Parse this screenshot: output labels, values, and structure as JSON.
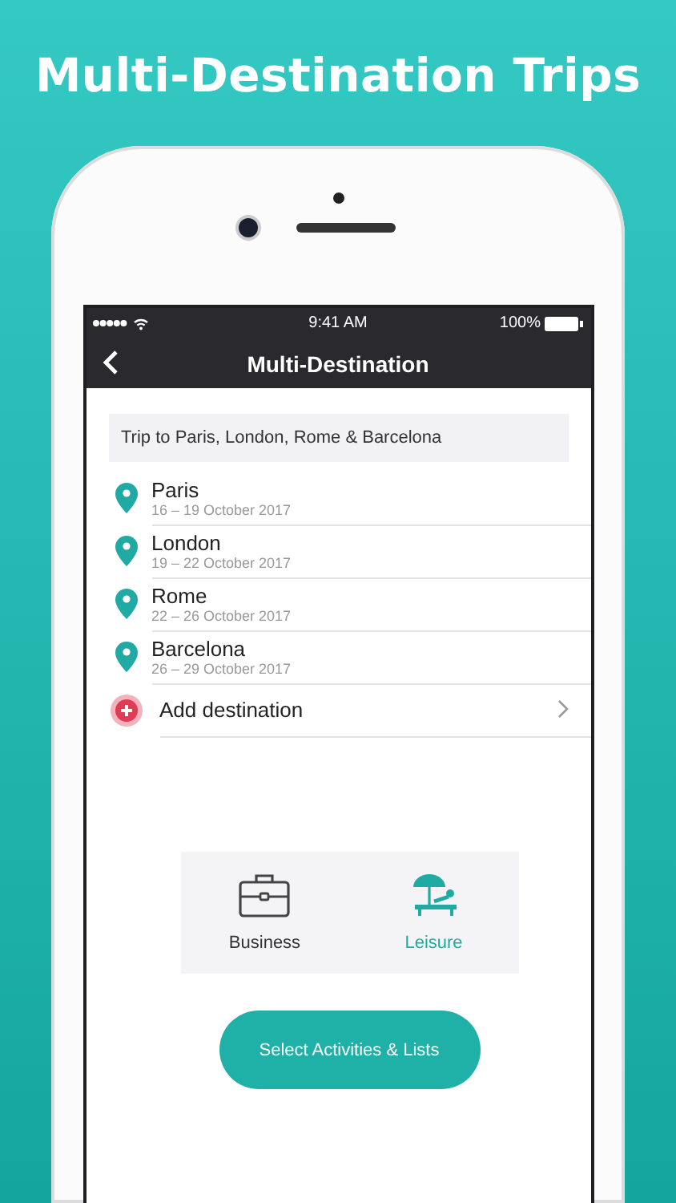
{
  "headline": "Multi-Destination Trips",
  "status_bar": {
    "time": "9:41 AM",
    "battery": "100%"
  },
  "nav": {
    "title": "Multi-Destination"
  },
  "trip_name": {
    "value": "Trip to Paris, London, Rome & Barcelona"
  },
  "destinations": [
    {
      "city": "Paris",
      "dates": "16 – 19 October 2017"
    },
    {
      "city": "London",
      "dates": "19 – 22 October 2017"
    },
    {
      "city": "Rome",
      "dates": "22 – 26 October 2017"
    },
    {
      "city": "Barcelona",
      "dates": "26 – 29 October 2017"
    }
  ],
  "add_destination": {
    "label": "Add destination"
  },
  "trip_types": [
    {
      "kind": "business",
      "label": "Business",
      "selected": false
    },
    {
      "kind": "leisure",
      "label": "Leisure",
      "selected": true
    }
  ],
  "action_button": {
    "label": "Select Activities & Lists"
  }
}
